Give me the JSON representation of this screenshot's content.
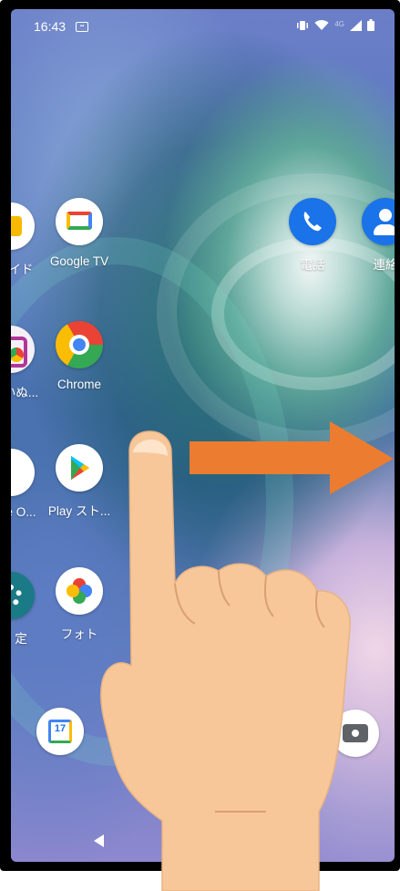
{
  "status_bar": {
    "time": "16:43",
    "notification_icon": "notification-badge-icon",
    "right_icons": [
      "vibrate-icon",
      "wifi-icon",
      "4g-icon",
      "signal-icon",
      "battery-icon"
    ],
    "network_label": "4G"
  },
  "home": {
    "apps_left_partial": [
      {
        "label": "イド",
        "icon": "guide-icon"
      },
      {
        "label": "いぬ...",
        "icon": "app-icon"
      },
      {
        "label": "e O...",
        "icon": "app-icon"
      },
      {
        "label": "定",
        "icon": "settings-icon"
      }
    ],
    "apps_column": [
      {
        "label": "Google TV",
        "icon": "google-tv-icon"
      },
      {
        "label": "Chrome",
        "icon": "chrome-icon"
      },
      {
        "label": "Play スト...",
        "icon": "play-store-icon"
      },
      {
        "label": "フォト",
        "icon": "photos-icon"
      }
    ],
    "apps_right": [
      {
        "label": "電話",
        "icon": "phone-icon"
      },
      {
        "label": "連絡",
        "icon": "contacts-icon"
      }
    ],
    "dock": {
      "calendar_day": "17",
      "calendar_icon": "calendar-icon",
      "camera_icon": "camera-icon"
    }
  },
  "overlay": {
    "gesture": "swipe-right",
    "arrow_color": "#ec7c30",
    "hand_color": "#f7c79a"
  },
  "nav_bar": {
    "back_icon": "back-triangle-icon"
  }
}
